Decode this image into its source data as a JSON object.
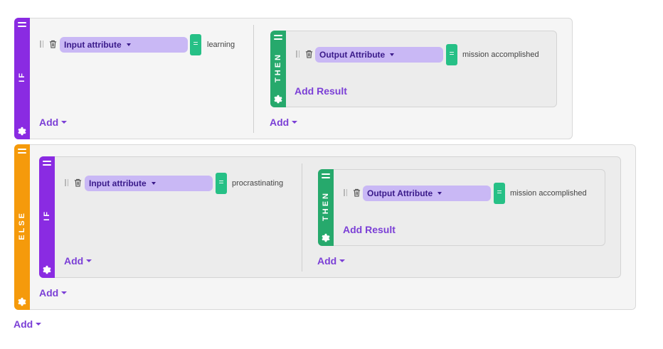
{
  "if_block": {
    "label": "IF",
    "condition": {
      "attribute_label": "Input attribute",
      "operator": "=",
      "value": "learning"
    },
    "add_label": "Add",
    "then_block": {
      "label": "THEN",
      "result": {
        "attribute_label": "Output Attribute",
        "operator": "=",
        "value": "mission accomplished"
      },
      "add_result_label": "Add Result"
    },
    "then_add_label": "Add"
  },
  "else_block": {
    "label": "ELSE",
    "add_label": "Add",
    "nested_if": {
      "label": "IF",
      "condition": {
        "attribute_label": "Input attribute",
        "operator": "=",
        "value": "procrastinating"
      },
      "add_label": "Add",
      "then_block": {
        "label": "THEN",
        "result": {
          "attribute_label": "Output Attribute",
          "operator": "=",
          "value": "mission accomplished"
        },
        "add_result_label": "Add Result"
      },
      "then_add_label": "Add"
    }
  },
  "root_add_label": "Add",
  "colors": {
    "if": "#8a2be2",
    "then": "#26a96c",
    "else": "#f59a0b",
    "selector": "#c9b8f5",
    "operator": "#26c086",
    "link": "#7b3fd6"
  }
}
